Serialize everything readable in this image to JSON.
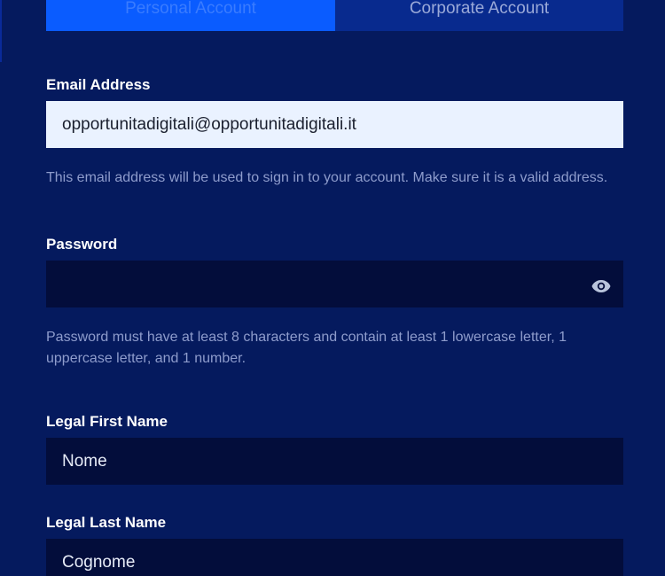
{
  "tabs": {
    "personal_label": "Personal Account",
    "corporate_label": "Corporate Account"
  },
  "email": {
    "label": "Email Address",
    "value": "opportunitadigitali@opportunitadigitali.it",
    "help": "This email address will be used to sign in to your account. Make sure it is a valid address."
  },
  "password": {
    "label": "Password",
    "value": "",
    "help": "Password must have at least 8 characters and contain at least 1 lowercase letter, 1 uppercase letter, and 1 number.",
    "toggle_icon": "eye-icon"
  },
  "first_name": {
    "label": "Legal First Name",
    "placeholder": "Nome"
  },
  "last_name": {
    "label": "Legal Last Name",
    "placeholder": "Cognome"
  },
  "colors": {
    "background": "#051a5e",
    "active_tab": "#0a5cff",
    "inactive_tab": "#082a8e",
    "input_dark": "#030d3b",
    "input_light": "#eaf2ff"
  }
}
